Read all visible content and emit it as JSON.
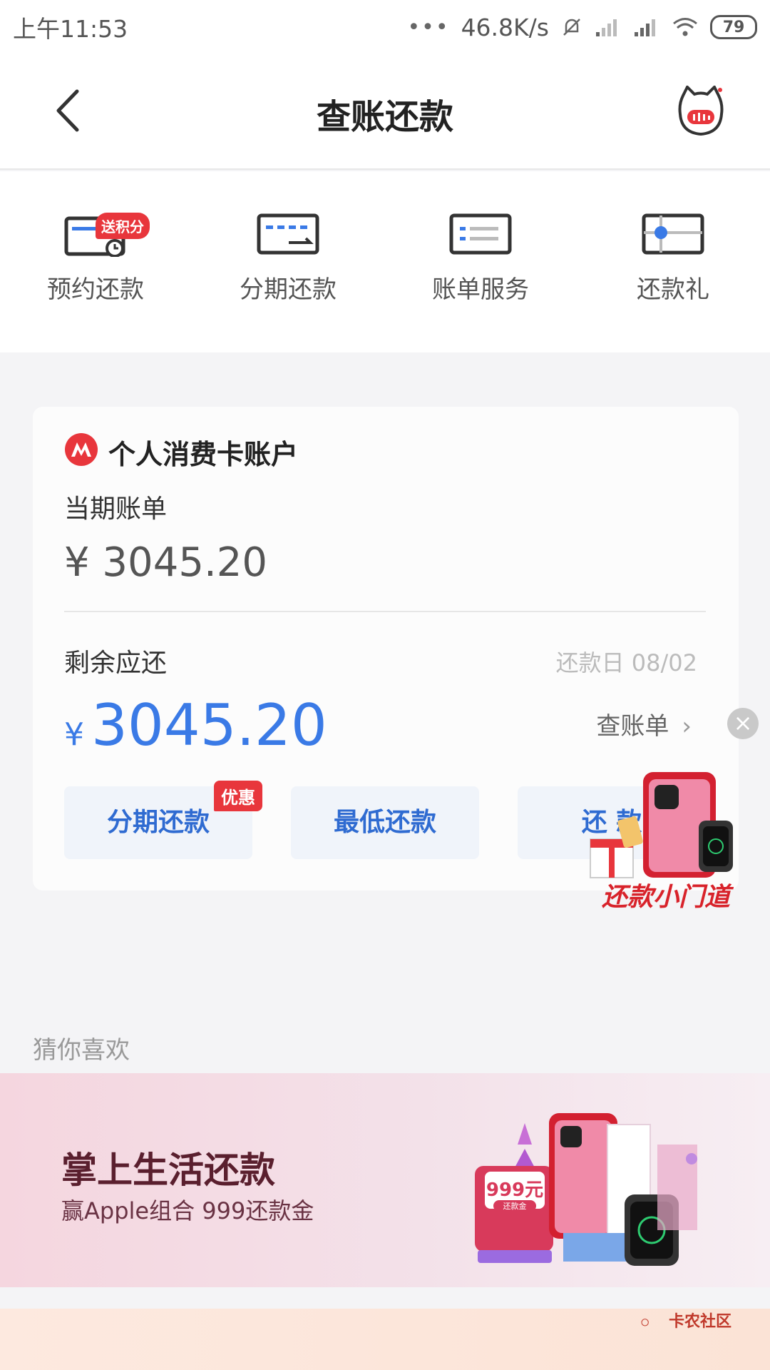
{
  "status_bar": {
    "time": "上午11:53",
    "dots": "•••",
    "network_speed": "46.8K/s",
    "battery": "79"
  },
  "nav": {
    "title": "查账还款"
  },
  "quick_menu": {
    "items": [
      {
        "label": "预约还款",
        "badge": "送积分"
      },
      {
        "label": "分期还款"
      },
      {
        "label": "账单服务"
      },
      {
        "label": "还款礼"
      }
    ],
    "page_count": 2,
    "active_page": 1
  },
  "card": {
    "account_title": "个人消费卡账户",
    "period_label": "当期账单",
    "period_amount": "¥ 3045.20",
    "remain_label": "剩余应还",
    "due_date": "还款日 08/02",
    "remain_yen": "¥",
    "remain_amount": "3045.20",
    "view_bill": "查账单",
    "buttons": {
      "installment": "分期还款",
      "installment_tag": "优惠",
      "minimum": "最低还款",
      "repay": "还  款"
    }
  },
  "float_ad": {
    "label": "还款小门道",
    "close": "×"
  },
  "recommend": {
    "section_label": "猜你喜欢",
    "banner_title": "掌上生活还款",
    "banner_sub": "赢Apple组合 999还款金",
    "banner_price": "999元",
    "banner_price_tag": "还款金"
  },
  "watermark": {
    "text": "卡农社区"
  },
  "colors": {
    "accent": "#3a7ae6",
    "badge_red": "#e8363c",
    "banner_pink": "#f5d6df"
  }
}
